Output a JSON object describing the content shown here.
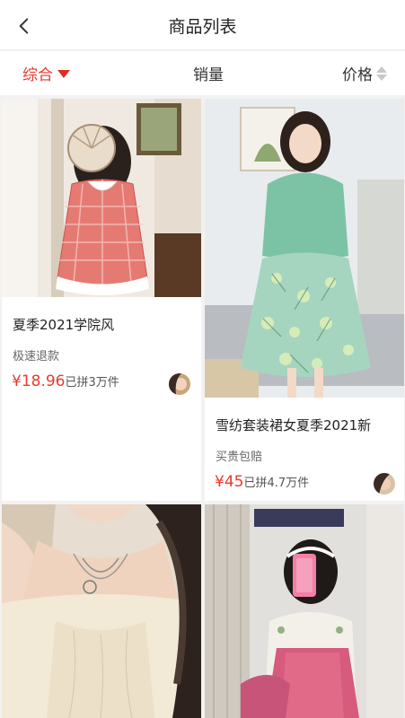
{
  "header": {
    "title": "商品列表"
  },
  "sort": {
    "comprehensive": "综合",
    "sales": "销量",
    "price": "价格"
  },
  "products": [
    {
      "title": "夏季2021学院风",
      "tag": "极速退款",
      "price": "¥18.96",
      "sold": "已拼3万件"
    },
    {
      "title": "雪纺套装裙女夏季2021新",
      "tag": "买贵包赔",
      "price": "¥45",
      "sold": "已拼4.7万件"
    },
    {
      "title": "",
      "tag": "",
      "price": "",
      "sold": ""
    },
    {
      "title": "",
      "tag": "",
      "price": "",
      "sold": ""
    }
  ],
  "colors": {
    "accent": "#e83a2e",
    "background": "#f2f2f2"
  },
  "icons": {
    "back": "chevron-left-icon",
    "sort_desc": "triangle-down-icon",
    "sort_both": "sort-up-down-icon"
  }
}
